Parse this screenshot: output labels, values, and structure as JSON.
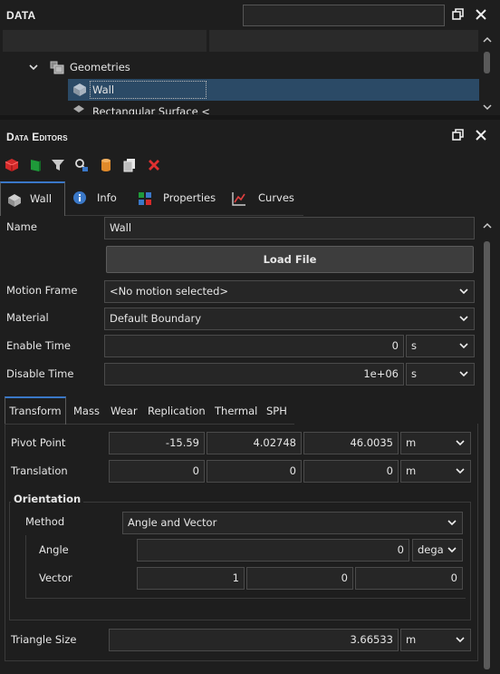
{
  "data_panel": {
    "title": "Data",
    "search": {
      "value": "",
      "placeholder": ""
    },
    "tree": {
      "folder_label": "Geometries",
      "selected_item": "Wall",
      "partial_item": "Rectangular Surface <"
    }
  },
  "editors_panel": {
    "title": "Data Editors",
    "toolbar_icons": [
      "red-cube-icon",
      "green-plane-icon",
      "filter-icon",
      "search-settings-icon",
      "cylinder-icon",
      "copy-icon",
      "delete-icon"
    ],
    "tabs": [
      "Wall",
      "Info",
      "Properties",
      "Curves"
    ],
    "active_tab": "Wall"
  },
  "form": {
    "name_label": "Name",
    "name_value": "Wall",
    "load_file_label": "Load File",
    "motion_frame_label": "Motion Frame",
    "motion_frame_value": "<No motion selected>",
    "material_label": "Material",
    "material_value": "Default Boundary",
    "enable_time_label": "Enable Time",
    "enable_time_value": "0",
    "enable_time_unit": "s",
    "disable_time_label": "Disable Time",
    "disable_time_value": "1e+06",
    "disable_time_unit": "s"
  },
  "subtabs": {
    "items": [
      "Transform",
      "Mass",
      "Wear",
      "Replication",
      "Thermal",
      "SPH"
    ],
    "active": "Transform"
  },
  "transform": {
    "pivot_label": "Pivot Point",
    "pivot_x": "-15.59",
    "pivot_y": "4.02748",
    "pivot_z": "46.0035",
    "pivot_unit": "m",
    "translation_label": "Translation",
    "trans_x": "0",
    "trans_y": "0",
    "trans_z": "0",
    "trans_unit": "m",
    "orientation_label": "Orientation",
    "method_label": "Method",
    "method_value": "Angle and Vector",
    "angle_label": "Angle",
    "angle_value": "0",
    "angle_unit": "dega",
    "vector_label": "Vector",
    "vec_x": "1",
    "vec_y": "0",
    "vec_z": "0",
    "triangle_size_label": "Triangle Size",
    "triangle_size_value": "3.66533",
    "triangle_size_unit": "m"
  },
  "colors": {
    "accent": "#3a78c8",
    "selection": "#2b4a66",
    "background": "#1e1e1e",
    "delete_red": "#e03030"
  }
}
